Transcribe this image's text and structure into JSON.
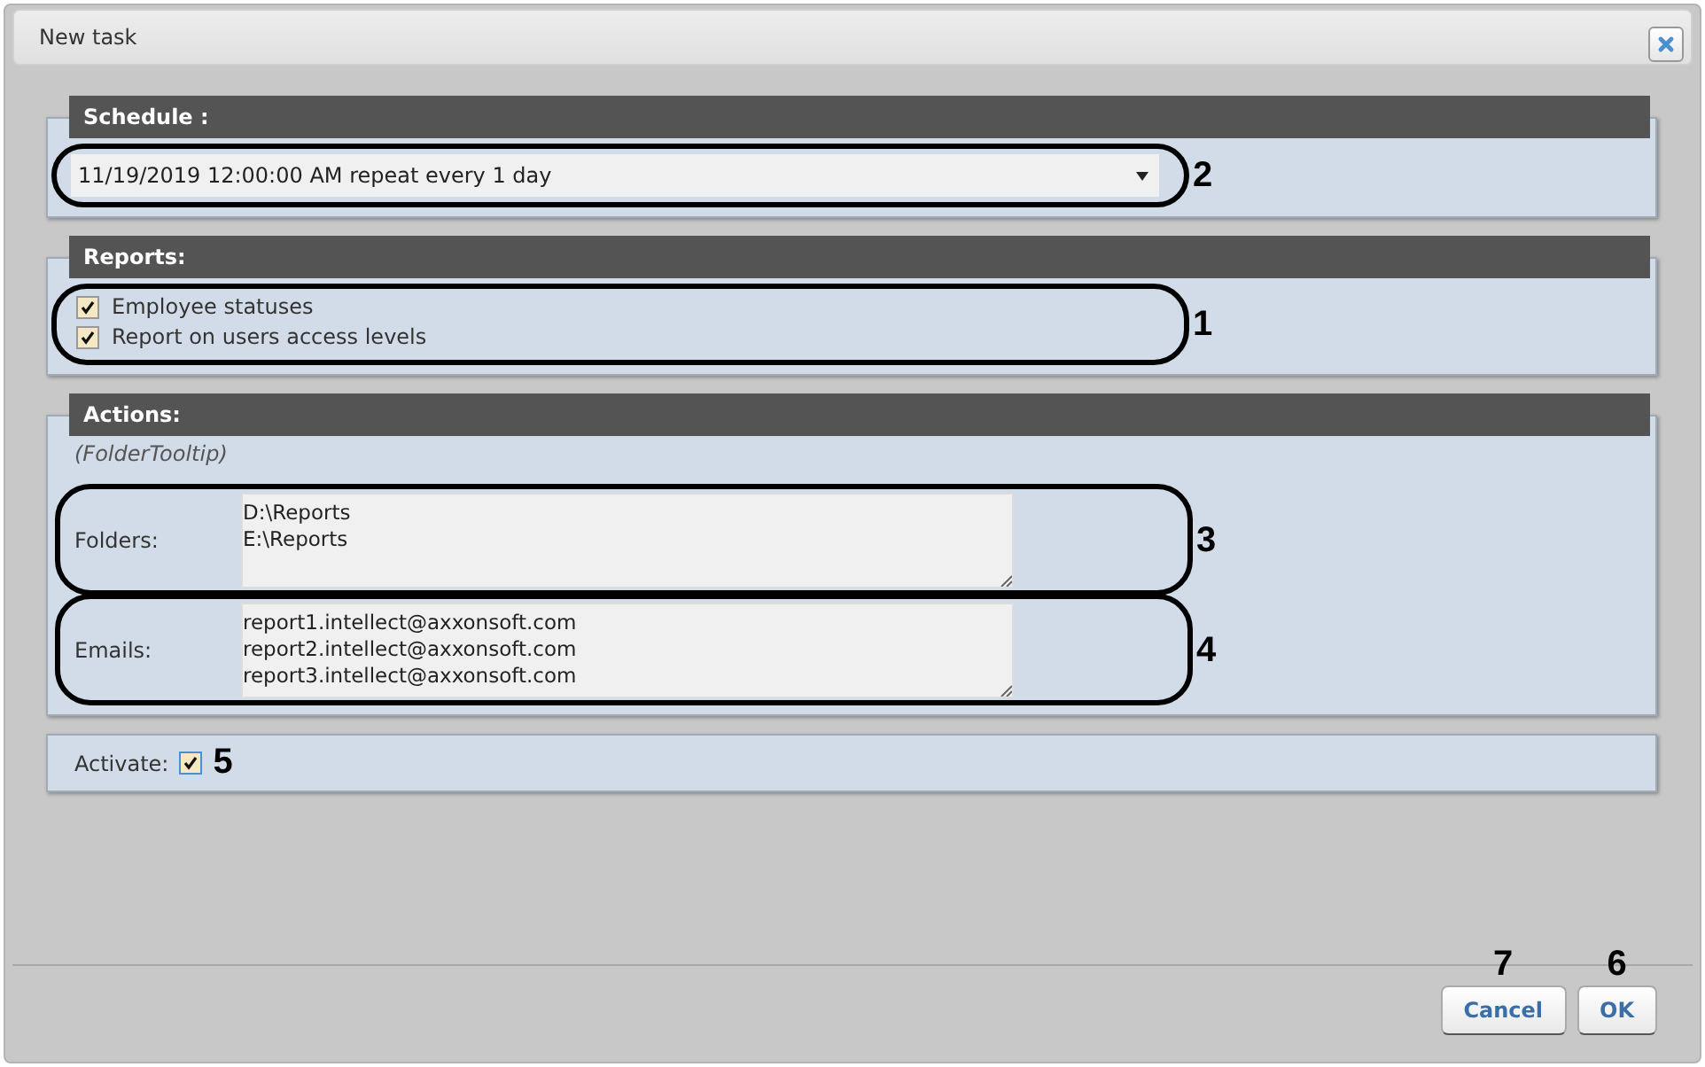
{
  "window": {
    "title": "New task"
  },
  "schedule": {
    "title": "Schedule :",
    "value": "11/19/2019 12:00:00 AM repeat every 1 day",
    "callout": "2"
  },
  "reports": {
    "title": "Reports:",
    "callout": "1",
    "items": [
      {
        "label": "Employee statuses",
        "checked": true
      },
      {
        "label": "Report on users access levels",
        "checked": true
      }
    ]
  },
  "actions": {
    "title": "Actions:",
    "tooltip": "(FolderTooltip)",
    "fields": [
      {
        "label": "Folders:",
        "lines": [
          "D:\\Reports",
          "E:\\Reports"
        ],
        "callout": "3"
      },
      {
        "label": "Emails:",
        "lines": [
          "report1.intellect@axxonsoft.com",
          "report2.intellect@axxonsoft.com",
          "report3.intellect@axxonsoft.com"
        ],
        "callout": "4"
      }
    ]
  },
  "activate": {
    "label": "Activate:",
    "checked": true,
    "callout": "5"
  },
  "buttons": [
    {
      "label": "Cancel",
      "callout": "7"
    },
    {
      "label": "OK",
      "callout": "6"
    }
  ]
}
